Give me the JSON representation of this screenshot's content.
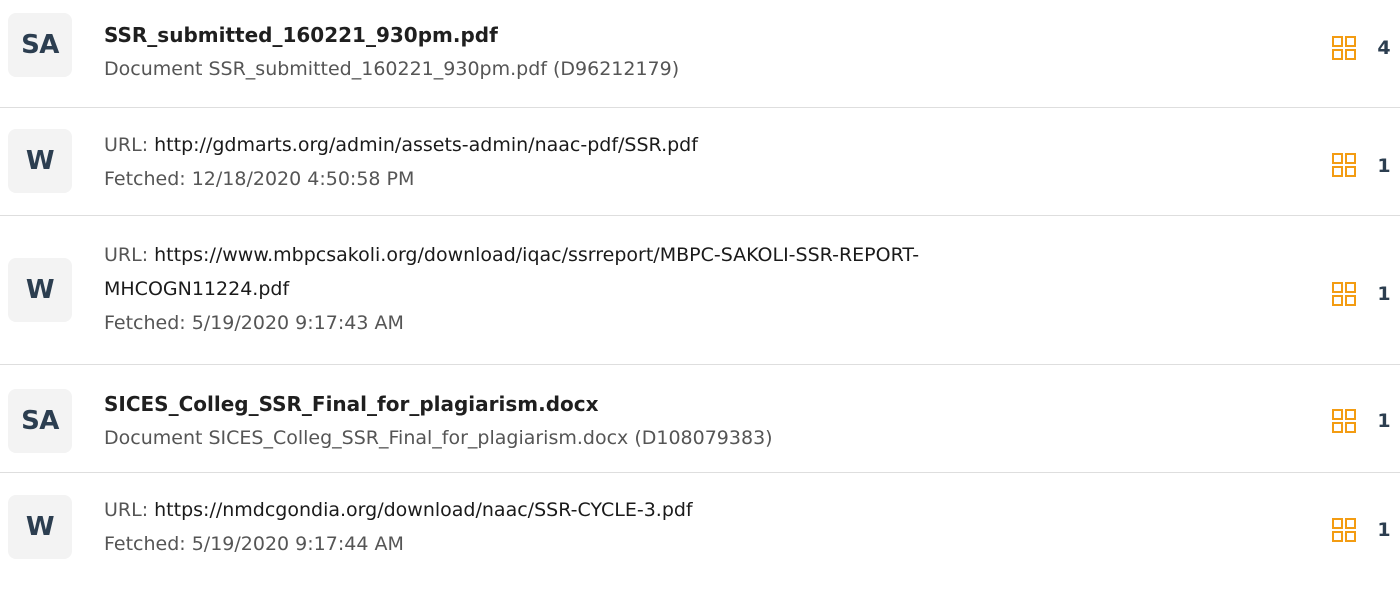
{
  "sources": [
    {
      "badge": "SA",
      "type": "document",
      "title": "SSR_submitted_160221_930pm.pdf",
      "detail": "Document SSR_submitted_160221_930pm.pdf (D96212179)",
      "count": "4"
    },
    {
      "badge": "W",
      "type": "web",
      "url_label": "URL: ",
      "url": "http://gdmarts.org/admin/assets-admin/naac-pdf/SSR.pdf",
      "fetched": "Fetched: 12/18/2020 4:50:58 PM",
      "count": "1"
    },
    {
      "badge": "W",
      "type": "web",
      "url_label": "URL: ",
      "url_line1": "https://www.mbpcsakoli.org/download/iqac/ssrreport/MBPC-SAKOLI-SSR-REPORT-",
      "url_line2": "MHCOGN11224.pdf",
      "fetched": "Fetched: 5/19/2020 9:17:43 AM",
      "count": "1"
    },
    {
      "badge": "SA",
      "type": "document",
      "title": "SICES_Colleg_SSR_Final_for_plagiarism.docx",
      "detail": "Document SICES_Colleg_SSR_Final_for_plagiarism.docx (D108079383)",
      "count": "1"
    },
    {
      "badge": "W",
      "type": "web",
      "url_label": "URL: ",
      "url": "https://nmdcgondia.org/download/naac/SSR-CYCLE-3.pdf",
      "fetched": "Fetched: 5/19/2020 9:17:44 AM",
      "count": "1"
    }
  ],
  "colors": {
    "accent": "#f39c12",
    "badge_bg": "#f3f3f3",
    "badge_text": "#2c3e50",
    "divider": "#dedede"
  },
  "icons": {
    "count_icon": "grid-icon"
  }
}
